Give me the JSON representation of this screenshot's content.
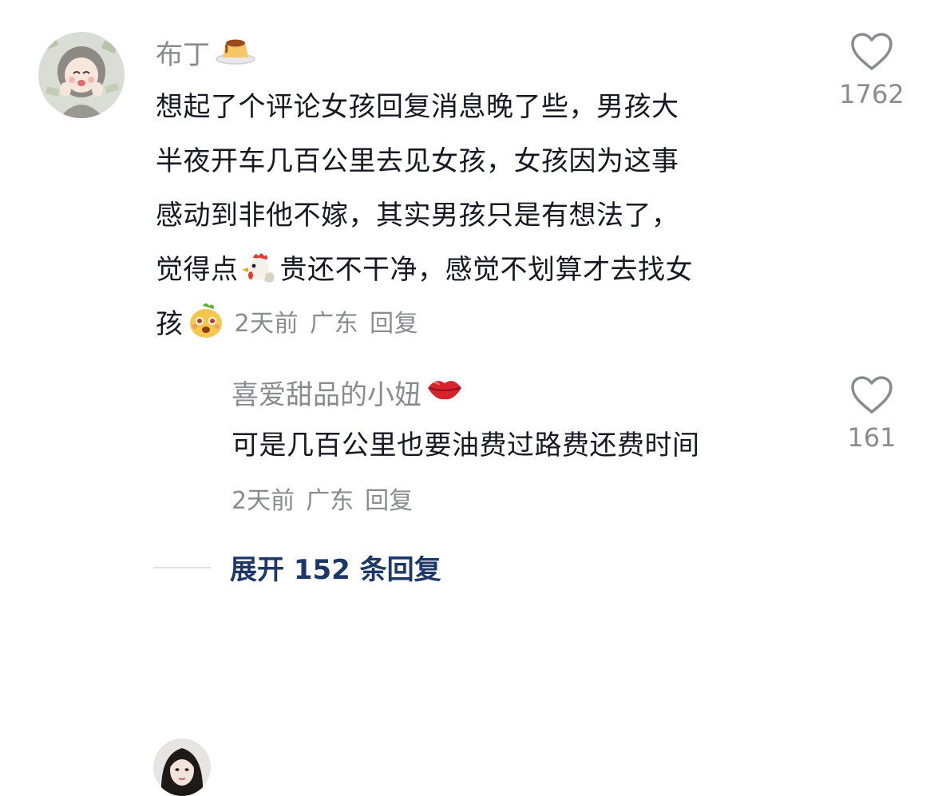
{
  "main_comment": {
    "username": "布丁",
    "username_emoji": "custard-pudding-emoji",
    "lines": [
      "想起了个评论女孩回复消息晚了些，男孩大",
      "半夜开车几百公里去见女孩，女孩因为这事",
      "感动到非他不嫁，其实男孩只是有想法了，"
    ],
    "line4_before": "觉得点",
    "line4_emoji": "rooster-emoji",
    "line4_after": "贵还不干净，感觉不划算才去找女",
    "line5_text": "孩",
    "line5_emoji": "cute-face-emoji",
    "time": "2天前",
    "location": "广东",
    "reply_label": "回复",
    "likes": "1762"
  },
  "reply_comment": {
    "username": "喜爱甜品的小妞",
    "username_emoji": "kiss-lips-emoji",
    "text": "可是几百公里也要油费过路费还费时间",
    "time": "2天前",
    "location": "广东",
    "reply_label": "回复",
    "likes": "161"
  },
  "expand_replies": {
    "label": "展开 152 条回复"
  },
  "colors": {
    "text": "#161823",
    "secondary": "#8a8b91",
    "expand_link": "#1c3868",
    "background": "#ffffff"
  }
}
